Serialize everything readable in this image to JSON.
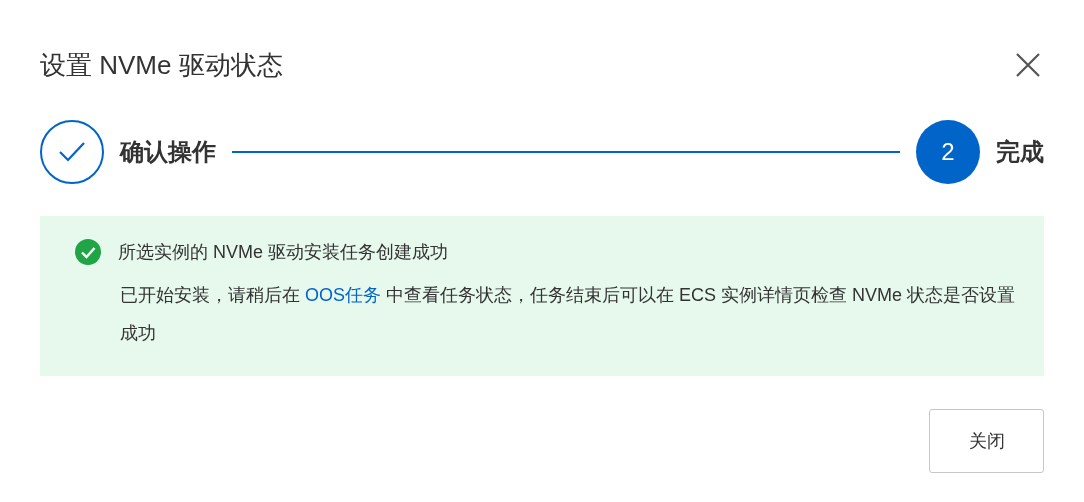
{
  "dialog": {
    "title": "设置 NVMe 驱动状态"
  },
  "steps": [
    {
      "label": "确认操作",
      "done": true
    },
    {
      "label": "完成",
      "done": false,
      "number": "2"
    }
  ],
  "alert": {
    "kind": "success",
    "title": "所选实例的 NVMe 驱动安装任务创建成功",
    "message_before": "已开始安装，请稍后在 ",
    "link": "OOS任务",
    "message_after": " 中查看任务状态，任务结束后可以在 ECS 实例详情页检查 NVMe 状态是否设置成功"
  },
  "buttons": [
    {
      "label": "关闭"
    }
  ]
}
